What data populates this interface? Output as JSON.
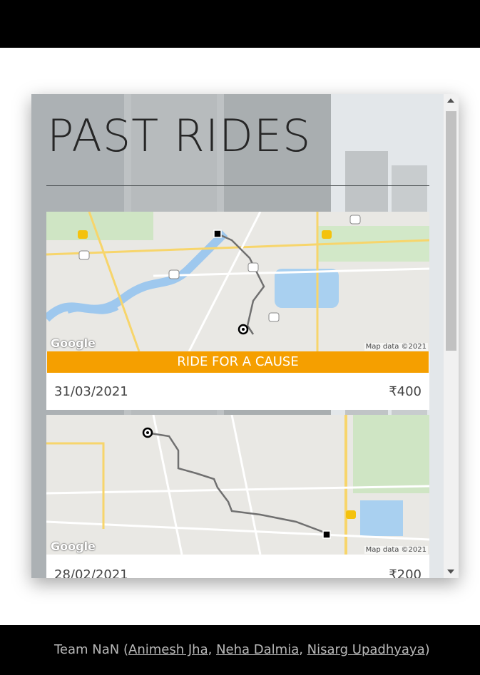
{
  "page": {
    "title": "PAST RIDES"
  },
  "rides": [
    {
      "tag": "RIDE FOR A CAUSE",
      "date": "31/03/2021",
      "price": "₹400",
      "map_attribution": "Map data ©2021",
      "map_brand": "Google"
    },
    {
      "tag": "",
      "date": "28/02/2021",
      "price": "₹200",
      "map_attribution": "Map data ©2021",
      "map_brand": "Google"
    }
  ],
  "footer": {
    "team_prefix": "Team NaN (",
    "members": [
      "Animesh Jha",
      "Neha Dalmia",
      "Nisarg Upadhyaya"
    ],
    "separator": ", ",
    "suffix": ")"
  },
  "colors": {
    "cause_tag": "#f59f00",
    "header_bar": "#000000",
    "footer_bar": "#000000"
  },
  "icons": {
    "scroll_up": "triangle-up-icon",
    "scroll_down": "triangle-down-icon",
    "pickup": "circle-marker-icon",
    "dropoff": "square-marker-icon"
  }
}
